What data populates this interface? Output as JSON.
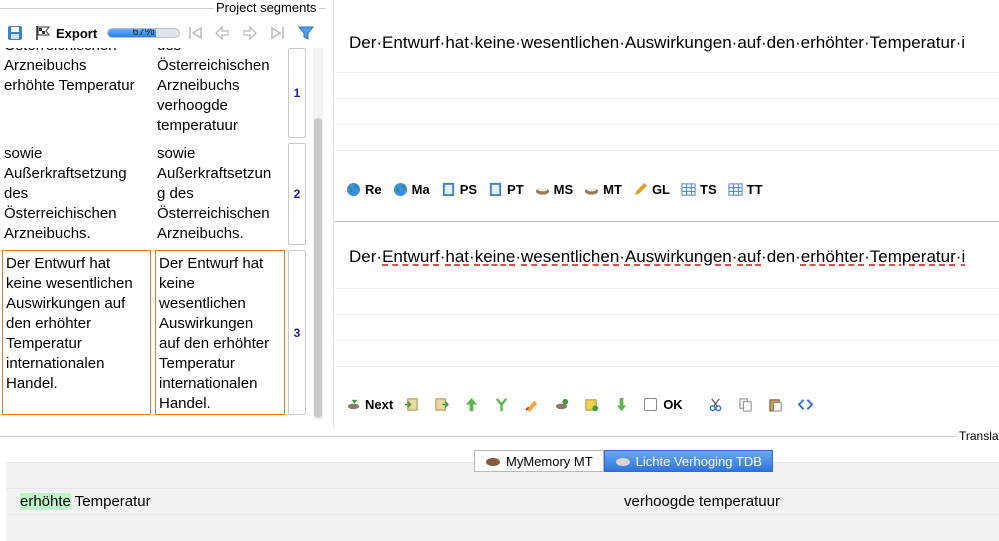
{
  "toolbar": {
    "export_label": "Export",
    "progress_text": "67%",
    "progress_value": 0.67
  },
  "panel": {
    "title": "Project segments"
  },
  "segments": [
    {
      "source": "Österreichischen\nArzneibuchs\nerhöhte Temperatur",
      "target": "des\nÖsterreichischen\n Arzneibuchs\nverhoogde\ntemperatuur",
      "number": "1"
    },
    {
      "source": "sowie\nAußerkraftsetzung\ndes\nÖsterreichischen\nArzneibuchs.",
      "target": "sowie\nAußerkraftsetzun\ng des\nÖsterreichischen\n Arzneibuchs.",
      "number": "2"
    },
    {
      "source": "Der Entwurf hat\nkeine wesentlichen\nAuswirkungen auf\nden erhöhter\nTemperatur\ninternationalen\nHandel.",
      "target": "Der Entwurf hat\nkeine\nwesentlichen\nAuswirkungen\nauf den erhöhter\nTemperatur\ninternationalen\nHandel.",
      "number": "3"
    }
  ],
  "editor": {
    "source_text": "Der·Entwurf·hat·keine·wesentlichen·Auswirkungen·auf·den·erhöhter·Temperatur·i",
    "target_words": [
      "Der",
      "·",
      "Entwurf",
      "·",
      "hat",
      "·",
      "keine",
      "·",
      "wesentlichen",
      "·",
      "Auswirkungen",
      "·",
      "auf",
      "·",
      "den",
      "·",
      "erhöhter",
      "·",
      "Temperatur",
      "·",
      "i"
    ]
  },
  "resource_buttons": [
    {
      "label": "Re",
      "icon": "globe-icon",
      "color": "#2e8b3a"
    },
    {
      "label": "Ma",
      "icon": "globe-icon",
      "color": "#2e8b3a"
    },
    {
      "label": "PS",
      "icon": "document-icon",
      "color": "#3d7fd6"
    },
    {
      "label": "PT",
      "icon": "document-icon",
      "color": "#3d7fd6"
    },
    {
      "label": "MS",
      "icon": "cup-icon",
      "color": "#9a7b55"
    },
    {
      "label": "MT",
      "icon": "cup-icon",
      "color": "#9a7b55"
    },
    {
      "label": "GL",
      "icon": "pencil-icon",
      "color": "#e0a030"
    },
    {
      "label": "TS",
      "icon": "table-icon",
      "color": "#3d7fd6"
    },
    {
      "label": "TT",
      "icon": "table-icon",
      "color": "#3d7fd6"
    }
  ],
  "edit_toolbar": {
    "next_label": "Next",
    "ok_label": "OK"
  },
  "translation_panel": {
    "title": "Transla"
  },
  "tabs": [
    {
      "label": "MyMemory MT",
      "selected": false
    },
    {
      "label": "Lichte Verhoging TDB",
      "selected": true
    }
  ],
  "match": {
    "source_highlight": "erhöhte",
    "source_rest": " Temperatur",
    "target": "verhoogde temperatuur"
  }
}
